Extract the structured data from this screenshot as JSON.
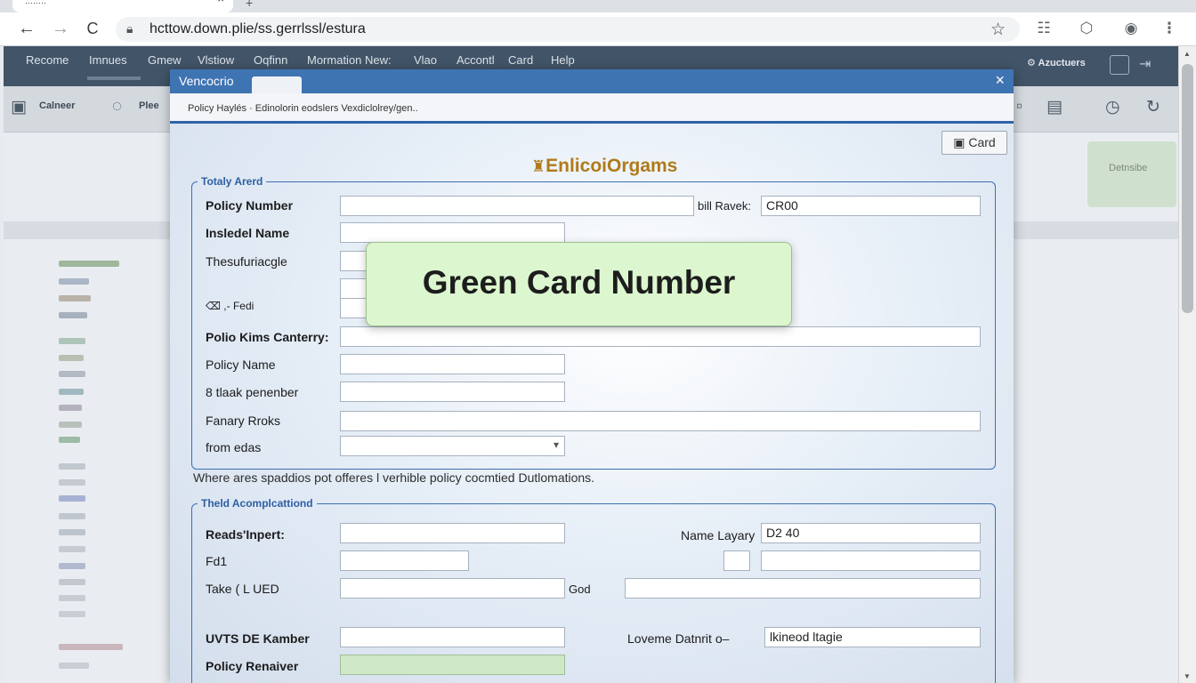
{
  "browser": {
    "tab_title": "········",
    "tab_close": "×",
    "new_tab": "+",
    "url": "hcttow.down.plie/ss.gerrlssl/estura",
    "back": "←",
    "forward": "→",
    "reload": "C"
  },
  "app": {
    "menu": [
      "Recome",
      "Imnues",
      "Gmew",
      "Vlstiow",
      "Oqfinn",
      "Mormation New:",
      "Vlao",
      "Accontl",
      "Card",
      "Help"
    ],
    "account_label": "⚙ Azuctuers",
    "toolbar": [
      "Calneer",
      "Plee"
    ],
    "side_button": "Detnsibe"
  },
  "dialog": {
    "title": "Vencocrio",
    "close_label": "×",
    "breadcrumb": "Policy  Haylés ·  Edinolorin eodslers Vexdiclolrey/gen..",
    "card_button": "Card",
    "brand": "EnlicoiOrgams",
    "group1": {
      "legend": "Totaly Arerd",
      "policy_number": "Policy Number",
      "bill_ravek_label": "bill Ravek:",
      "bill_ravek_value": "CR00",
      "insured_name": "Insledel Name",
      "thesuf": "Thesufuriacgle",
      "fedi": "⌫ ,- Fedi",
      "polio_kims": "Polio Kims Canterry:",
      "policy_name": "Policy Name",
      "tlaak": "8 tlaak penenber",
      "fanary": "Fanary Rroks",
      "from_edas": "from edas"
    },
    "note": "Where ares spaddios pot offeres l verhible policy cocmtied Dutlomations.",
    "group2": {
      "legend": "Theld Acomplcattiond",
      "reads_inpert": "Reads'Inpert:",
      "name_layary_label": "Name Layary",
      "name_layary_value": "D2 40",
      "fd1": "Fd1",
      "take_lued": "Take ( L UED",
      "god": "God",
      "uvts": "UVTS DE Kamber",
      "loveme_label": "Loveme Datnrit o–",
      "loveme_value": "lkineod ltagie",
      "policy_renaiver": "Policy Renaiver"
    }
  },
  "popup": {
    "text": "Green Card Number"
  }
}
